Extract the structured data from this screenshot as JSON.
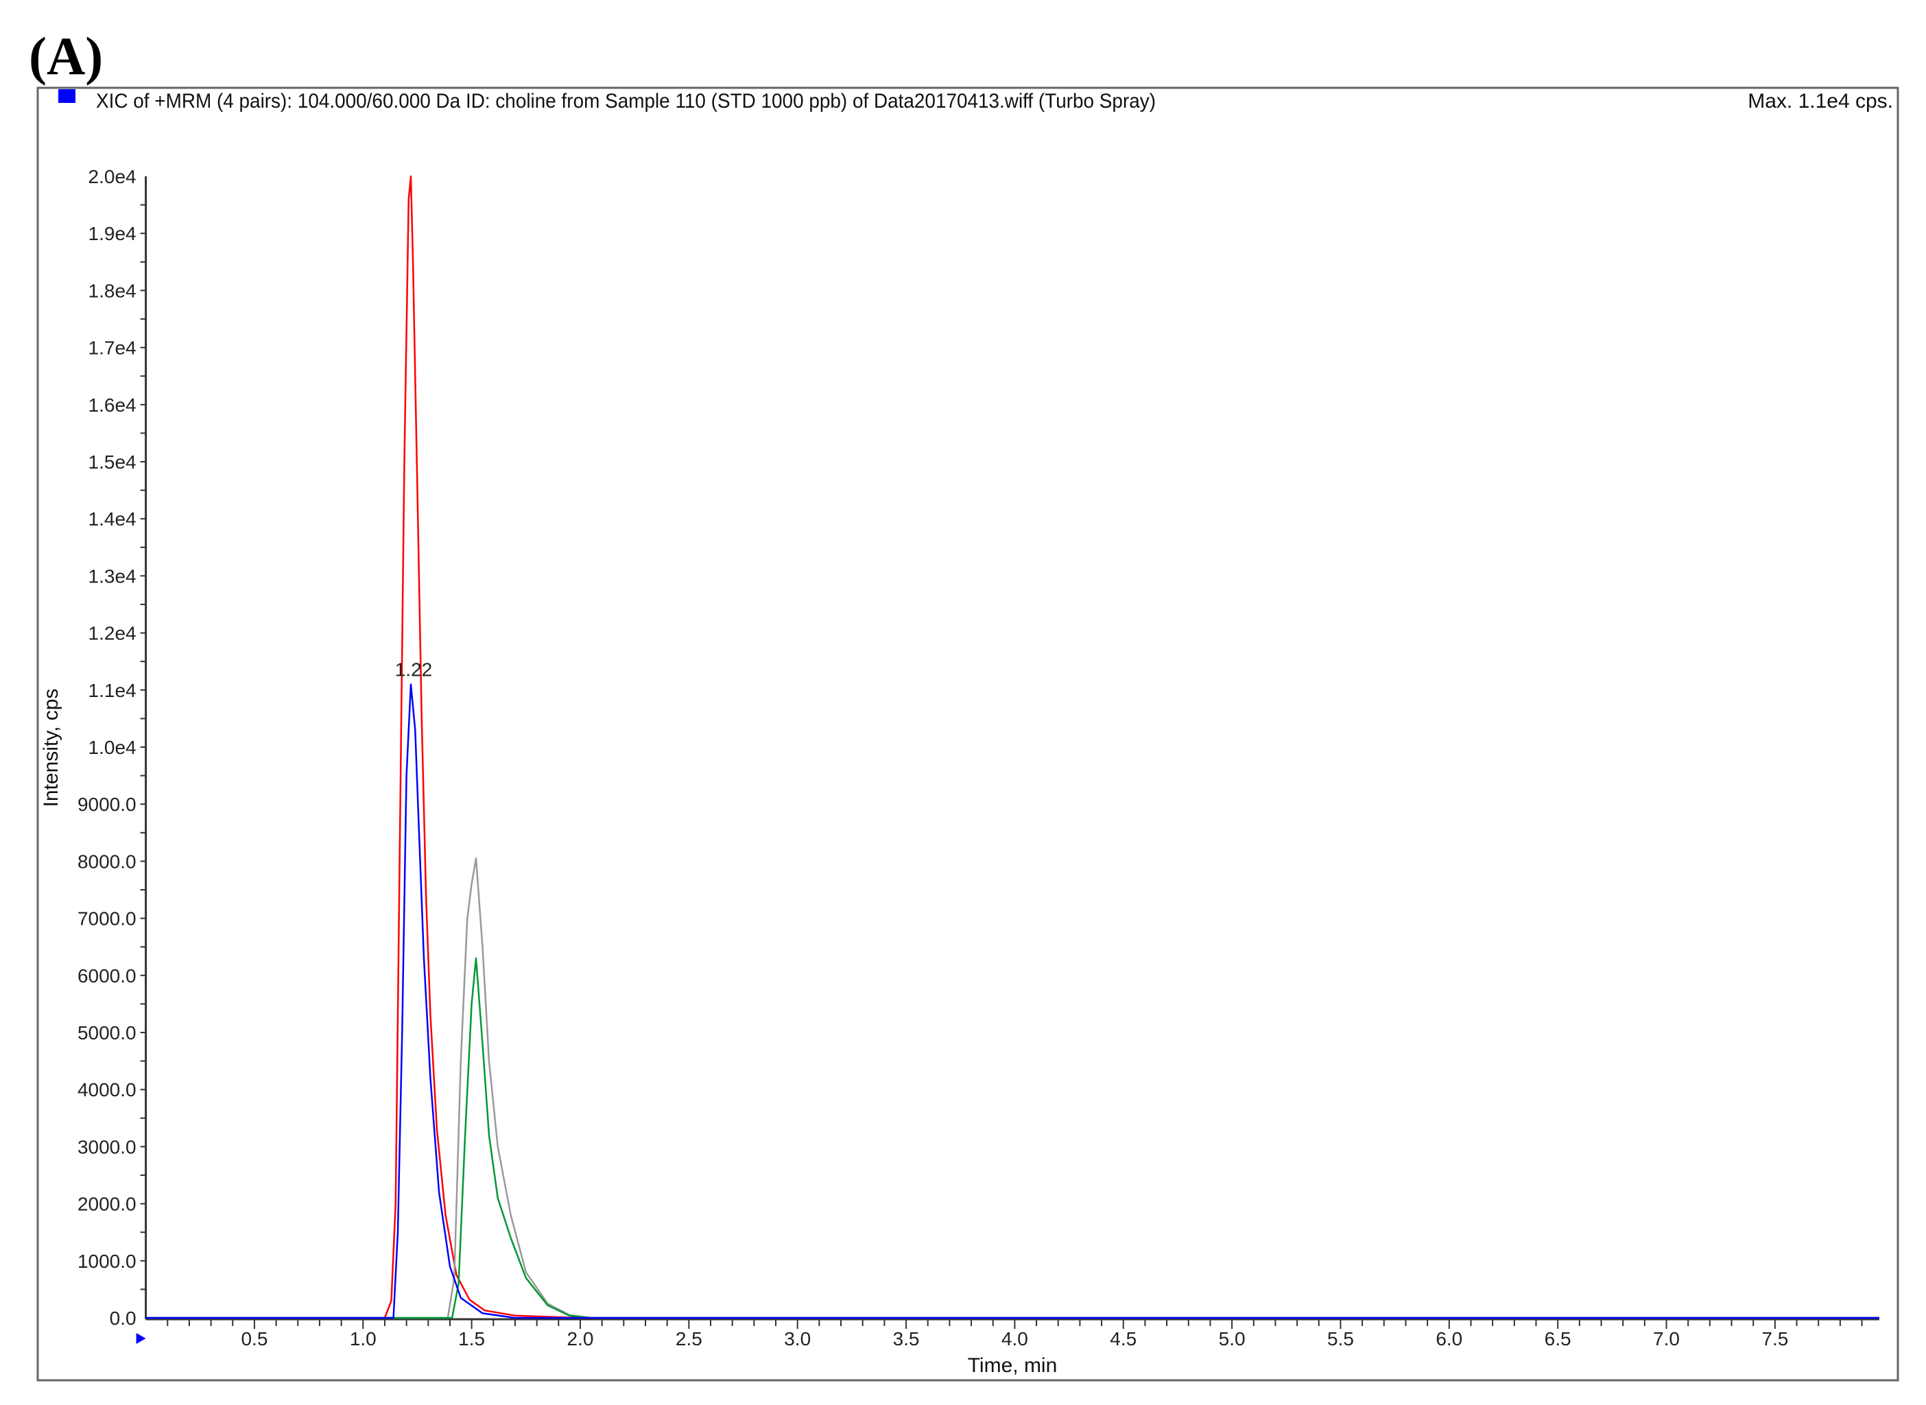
{
  "panel_label": "(A)",
  "chart_data": {
    "type": "line",
    "title": "XIC of +MRM (4 pairs): 104.000/60.000 Da ID: choline from Sample 110 (STD 1000 ppb) of Data20170413.wiff (Turbo Spray)",
    "max_label": "Max. 1.1e4 cps.",
    "xlabel": "Time, min",
    "ylabel": "Intensity, cps",
    "xlim": [
      0,
      7.98
    ],
    "ylim": [
      0,
      20000
    ],
    "grid": false,
    "legend_color": "#0000ff",
    "x_ticks": [
      "0.5",
      "1.0",
      "1.5",
      "2.0",
      "2.5",
      "3.0",
      "3.5",
      "4.0",
      "4.5",
      "5.0",
      "5.5",
      "6.0",
      "6.5",
      "7.0",
      "7.5"
    ],
    "x_tick_values": [
      0.5,
      1.0,
      1.5,
      2.0,
      2.5,
      3.0,
      3.5,
      4.0,
      4.5,
      5.0,
      5.5,
      6.0,
      6.5,
      7.0,
      7.5
    ],
    "y_ticks": [
      "0.0",
      "1000.0",
      "2000.0",
      "3000.0",
      "4000.0",
      "5000.0",
      "6000.0",
      "7000.0",
      "8000.0",
      "9000.0",
      "1.0e4",
      "1.1e4",
      "1.2e4",
      "1.3e4",
      "1.4e4",
      "1.5e4",
      "1.6e4",
      "1.7e4",
      "1.8e4",
      "1.9e4",
      "2.0e4"
    ],
    "y_tick_values": [
      0,
      1000,
      2000,
      3000,
      4000,
      5000,
      6000,
      7000,
      8000,
      9000,
      10000,
      11000,
      12000,
      13000,
      14000,
      15000,
      16000,
      17000,
      18000,
      19000,
      20000
    ],
    "annotations": [
      {
        "text": "1.22",
        "x": 1.22,
        "y": 11100
      }
    ],
    "series": [
      {
        "name": "red",
        "color": "#ff0000",
        "x": [
          0,
          1.1,
          1.13,
          1.15,
          1.17,
          1.19,
          1.21,
          1.22,
          1.23,
          1.25,
          1.27,
          1.29,
          1.31,
          1.34,
          1.38,
          1.43,
          1.49,
          1.56,
          1.7,
          2.0,
          7.98
        ],
        "y": [
          0,
          0,
          300,
          2000,
          8500,
          15000,
          19600,
          20000,
          18500,
          14500,
          10500,
          7400,
          5300,
          3300,
          1800,
          750,
          320,
          130,
          40,
          0,
          0
        ]
      },
      {
        "name": "gray",
        "color": "#999999",
        "x": [
          0,
          1.39,
          1.42,
          1.45,
          1.48,
          1.5,
          1.52,
          1.55,
          1.58,
          1.62,
          1.68,
          1.75,
          1.85,
          1.95,
          2.05,
          7.98
        ],
        "y": [
          0,
          0,
          700,
          4500,
          7000,
          7600,
          8050,
          6500,
          4500,
          3000,
          1800,
          800,
          250,
          50,
          0,
          0
        ]
      },
      {
        "name": "green",
        "color": "#009933",
        "x": [
          0,
          1.41,
          1.44,
          1.47,
          1.5,
          1.52,
          1.55,
          1.58,
          1.62,
          1.68,
          1.75,
          1.85,
          1.95,
          2.05,
          7.98
        ],
        "y": [
          0,
          0,
          600,
          3200,
          5500,
          6300,
          4800,
          3200,
          2100,
          1400,
          700,
          220,
          40,
          0,
          0
        ]
      },
      {
        "name": "blue",
        "color": "#0000ff",
        "x": [
          0,
          1.14,
          1.16,
          1.18,
          1.2,
          1.22,
          1.24,
          1.26,
          1.28,
          1.31,
          1.35,
          1.4,
          1.45,
          1.55,
          1.7,
          7.98
        ],
        "y": [
          0,
          0,
          1500,
          5000,
          9500,
          11100,
          10300,
          8300,
          6300,
          4200,
          2200,
          900,
          350,
          80,
          0,
          0
        ]
      }
    ]
  }
}
